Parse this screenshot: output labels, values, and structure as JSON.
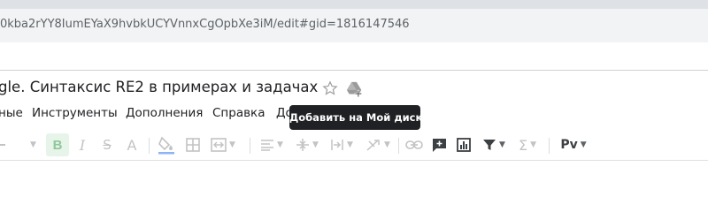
{
  "browser": {
    "url": "0kba2rYY8IumEYaX9hvbkUCYVnnxCgOpbXe3iM/edit#gid=1816147546"
  },
  "document": {
    "title": "gle. Синтаксис RE2 в примерах и задачах"
  },
  "menu": {
    "items": [
      "ные",
      "Инструменты",
      "Дополнения",
      "Справка",
      "До"
    ]
  },
  "tooltip": {
    "text": "Добавить на Мой диск"
  },
  "toolbar": {
    "bold_label": "B",
    "italic_label": "I",
    "strike_label": "S",
    "text_color_label": "A",
    "sigma_label": "Σ",
    "input_tools_label": "Pv",
    "icons": [
      "font-size-caret-icon",
      "bold-icon",
      "italic-icon",
      "strikethrough-icon",
      "text-color-icon",
      "fill-color-icon",
      "borders-icon",
      "merge-cells-icon",
      "horizontal-align-icon",
      "vertical-align-icon",
      "text-wrap-icon",
      "text-rotation-icon",
      "link-icon",
      "comment-icon",
      "chart-icon",
      "filter-icon",
      "functions-icon",
      "input-tools-icon"
    ]
  },
  "colors": {
    "tooltip_bg": "#202124",
    "bold_active_bg": "#e6f4ea",
    "url_bar_bg": "#f1f3f4"
  }
}
